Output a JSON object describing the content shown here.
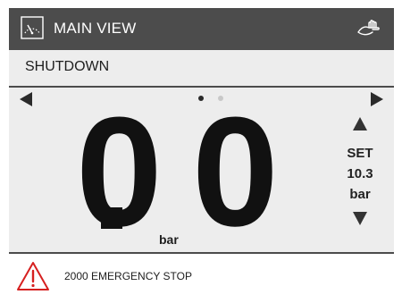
{
  "header": {
    "view_icon": "gauge-icon",
    "title": "MAIN VIEW",
    "mode_icon": "hand-icon"
  },
  "status": {
    "text": "SHUTDOWN"
  },
  "pager": {
    "left_icon": "arrow-left-icon",
    "right_icon": "arrow-right-icon",
    "page_count": 2,
    "active_page": 1
  },
  "reading": {
    "integer_part": "0",
    "fractional_part": "0",
    "unit": "bar"
  },
  "setpoint": {
    "label": "SET",
    "value": "10.3",
    "unit": "bar",
    "up_icon": "arrow-up-icon",
    "down_icon": "arrow-down-icon"
  },
  "alarm": {
    "icon": "warning-icon",
    "text": "2000 EMERGENCY STOP"
  },
  "colors": {
    "header_bg": "#4c4c4c",
    "screen_bg": "#ededed",
    "warning": "#d62020"
  }
}
